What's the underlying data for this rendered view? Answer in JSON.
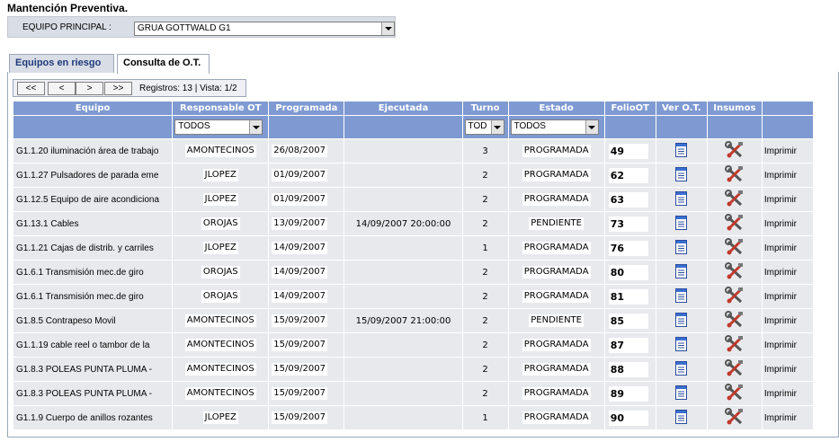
{
  "page": {
    "title": "Mantención Preventiva."
  },
  "equipo": {
    "label": "EQUIPO PRINCIPAL :",
    "selected": "GRUA GOTTWALD G1"
  },
  "tabs": [
    {
      "label": "Equipos en riesgo",
      "active": false
    },
    {
      "label": "Consulta de O.T.",
      "active": true
    }
  ],
  "pager": {
    "first": "<<",
    "prev": "<",
    "next": ">",
    "last": ">>",
    "info": "Registros: 13 | Vista: 1/2"
  },
  "table": {
    "headers": [
      "Equipo",
      "Responsable OT",
      "Programada",
      "Ejecutada",
      "Turno",
      "Estado",
      "FolioOT",
      "Ver O.T.",
      "Insumos",
      ""
    ],
    "filters": {
      "responsable": "TODOS",
      "turno": "TOD",
      "estado": "TODOS"
    },
    "rows": [
      {
        "equipo": "G1.1.20  iluminación área de trabajo",
        "responsable": "AMONTECINOS",
        "programada": "26/08/2007",
        "ejecutada": "",
        "turno": "3",
        "estado": "PROGRAMADA",
        "folio": "49",
        "print": "Imprimir"
      },
      {
        "equipo": "G1.1.27  Pulsadores de parada eme",
        "responsable": "JLOPEZ",
        "programada": "01/09/2007",
        "ejecutada": "",
        "turno": "2",
        "estado": "PROGRAMADA",
        "folio": "62",
        "print": "Imprimir"
      },
      {
        "equipo": "G1.12.5  Equipo de aire acondiciona",
        "responsable": "JLOPEZ",
        "programada": "01/09/2007",
        "ejecutada": "",
        "turno": "2",
        "estado": "PROGRAMADA",
        "folio": "63",
        "print": "Imprimir"
      },
      {
        "equipo": "G1.13.1  Cables",
        "responsable": "OROJAS",
        "programada": "13/09/2007",
        "ejecutada": "14/09/2007 20:00:00",
        "turno": "2",
        "estado": "PENDIENTE",
        "folio": "73",
        "print": "Imprimir"
      },
      {
        "equipo": "G1.1.21  Cajas de distrib. y carriles",
        "responsable": "JLOPEZ",
        "programada": "14/09/2007",
        "ejecutada": "",
        "turno": "1",
        "estado": "PROGRAMADA",
        "folio": "76",
        "print": "Imprimir"
      },
      {
        "equipo": "G1.6.1    Transmisión mec.de giro",
        "responsable": "OROJAS",
        "programada": "14/09/2007",
        "ejecutada": "",
        "turno": "2",
        "estado": "PROGRAMADA",
        "folio": "80",
        "print": "Imprimir"
      },
      {
        "equipo": "G1.6.1    Transmisión mec.de giro",
        "responsable": "OROJAS",
        "programada": "14/09/2007",
        "ejecutada": "",
        "turno": "2",
        "estado": "PROGRAMADA",
        "folio": "81",
        "print": "Imprimir"
      },
      {
        "equipo": "G1.8.5     Contrapeso Movil",
        "responsable": "AMONTECINOS",
        "programada": "15/09/2007",
        "ejecutada": "15/09/2007 21:00:00",
        "turno": "2",
        "estado": "PENDIENTE",
        "folio": "85",
        "print": "Imprimir"
      },
      {
        "equipo": "G1.1.19   cable reel   o tambor de la",
        "responsable": "AMONTECINOS",
        "programada": "15/09/2007",
        "ejecutada": "",
        "turno": "2",
        "estado": "PROGRAMADA",
        "folio": "87",
        "print": "Imprimir"
      },
      {
        "equipo": "G1.8.3    POLEAS PUNTA PLUMA -",
        "responsable": "AMONTECINOS",
        "programada": "15/09/2007",
        "ejecutada": "",
        "turno": "2",
        "estado": "PROGRAMADA",
        "folio": "88",
        "print": "Imprimir"
      },
      {
        "equipo": "G1.8.3    POLEAS PUNTA PLUMA -",
        "responsable": "AMONTECINOS",
        "programada": "15/09/2007",
        "ejecutada": "",
        "turno": "2",
        "estado": "PROGRAMADA",
        "folio": "89",
        "print": "Imprimir"
      },
      {
        "equipo": "G1.1.9    Cuerpo de anillos rozantes",
        "responsable": "JLOPEZ",
        "programada": "15/09/2007",
        "ejecutada": "",
        "turno": "1",
        "estado": "PROGRAMADA",
        "folio": "90",
        "print": "Imprimir"
      }
    ]
  },
  "icons": {
    "view": "document-icon",
    "supplies": "tools-icon"
  },
  "colors": {
    "header_bg": "#7f9ad2",
    "row_bg": "#e8e9ed",
    "tab_text": "#1f3a7a"
  }
}
